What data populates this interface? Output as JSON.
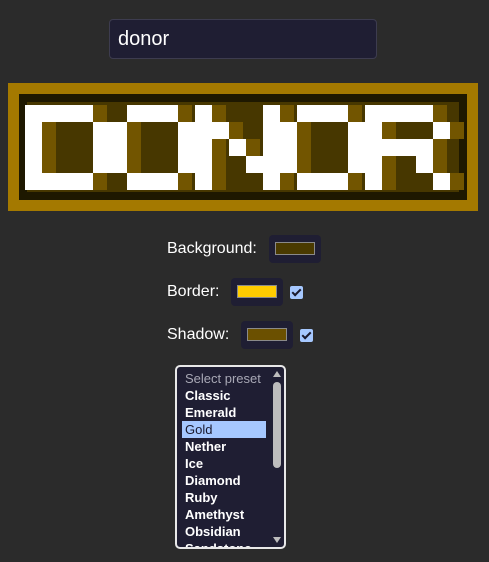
{
  "text_input": {
    "value": "donor"
  },
  "banner": {
    "text": "DONOR",
    "colors": {
      "background": "#473700",
      "border": "#a47900",
      "letter": "#ffffff",
      "shadow": "#725500",
      "inner_frame": "#1e1800"
    }
  },
  "controls": {
    "background": {
      "label": "Background:",
      "color": "#4a3a00"
    },
    "border": {
      "label": "Border:",
      "color": "#ffcc00",
      "enabled": true
    },
    "shadow": {
      "label": "Shadow:",
      "color": "#6b5000",
      "enabled": true
    }
  },
  "presets": {
    "placeholder": "Select preset",
    "selected": "Gold",
    "items": [
      "Select preset",
      "Classic",
      "Emerald",
      "Gold",
      "Nether",
      "Ice",
      "Diamond",
      "Ruby",
      "Amethyst",
      "Obsidian",
      "Sandstone"
    ]
  }
}
